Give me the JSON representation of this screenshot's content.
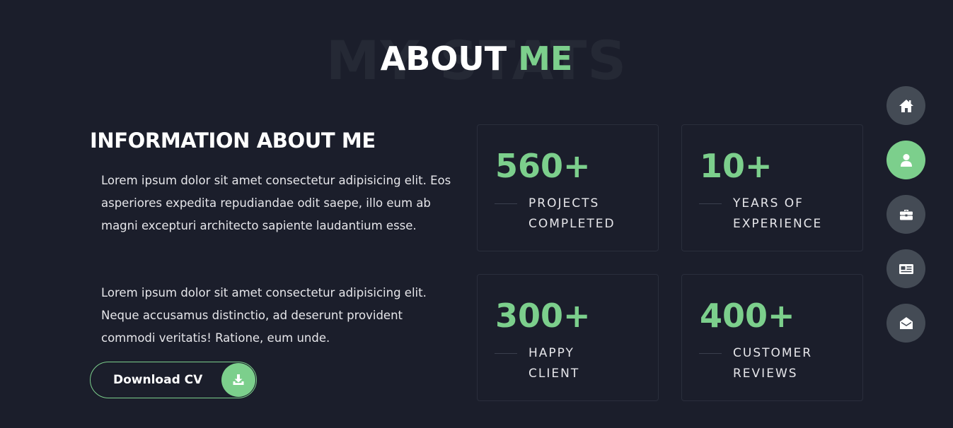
{
  "section": {
    "bg_title": "MY STATS",
    "title_main": "ABOUT",
    "title_accent": "ME"
  },
  "info": {
    "title": "INFORMATION ABOUT ME",
    "paragraph_1": "Lorem ipsum dolor sit amet consectetur adipisicing elit. Eos asperiores expedita repudiandae odit saepe, illo eum ab magni excepturi architecto sapiente laudantium esse.",
    "paragraph_2": "Lorem ipsum dolor sit amet consectetur adipisicing elit. Neque accusamus distinctio, ad deserunt provident commodi veritatis! Ratione, eum unde.",
    "download_label": "Download CV"
  },
  "stats": [
    {
      "value": "560+",
      "label_line1": "PROJECTS",
      "label_line2": "COMPLETED"
    },
    {
      "value": "10+",
      "label_line1": "YEARS OF",
      "label_line2": "EXPERIENCE"
    },
    {
      "value": "300+",
      "label_line1": "HAPPY",
      "label_line2": "CLIENT"
    },
    {
      "value": "400+",
      "label_line1": "CUSTOMER",
      "label_line2": "REVIEWS"
    }
  ],
  "nav": [
    {
      "icon": "home-icon",
      "active": false
    },
    {
      "icon": "user-icon",
      "active": true
    },
    {
      "icon": "briefcase-icon",
      "active": false
    },
    {
      "icon": "newspaper-icon",
      "active": false
    },
    {
      "icon": "envelope-open-icon",
      "active": false
    }
  ],
  "colors": {
    "background": "#1b1e2b",
    "accent": "#7ccf8c",
    "nav_inactive": "#444b55",
    "card_border": "#2a2e3c",
    "heading_watermark": "#252935"
  }
}
